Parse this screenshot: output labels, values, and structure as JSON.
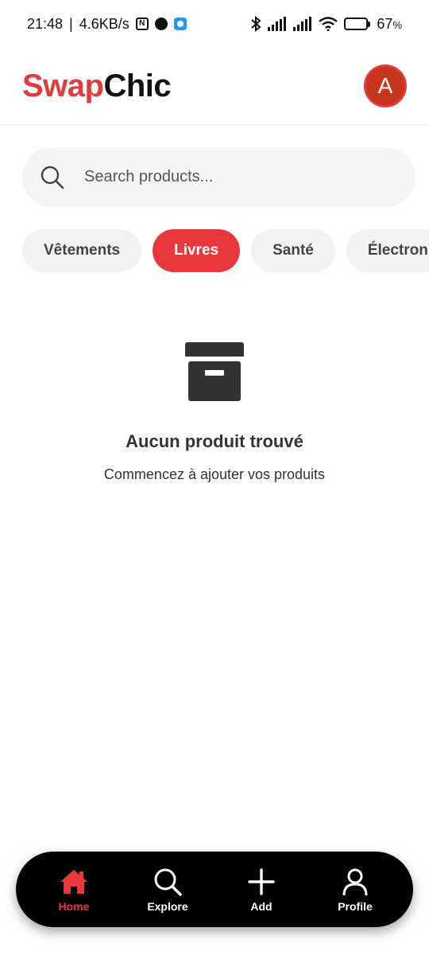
{
  "status_bar": {
    "time": "21:48",
    "network_speed": "4.6KB/s",
    "battery_percent": "67",
    "battery_unit": "%",
    "battery_level": 0.67,
    "icons": [
      "nfc-icon",
      "notification-icon",
      "app-notification-icon",
      "bluetooth-icon",
      "signal-icon",
      "signal-icon",
      "wifi-icon",
      "battery-icon"
    ]
  },
  "header": {
    "logo_part1": "Swap",
    "logo_part2": "Chic",
    "avatar_letter": "A",
    "colors": {
      "logo_accent": "#e23b3b",
      "avatar_bg": "#c7361c"
    }
  },
  "search": {
    "placeholder": "Search products...",
    "value": ""
  },
  "categories": {
    "items": [
      "Vêtements",
      "Livres",
      "Santé",
      "Électronique"
    ],
    "selected": "Livres",
    "active_color": "#e8383d"
  },
  "empty_state": {
    "icon": "archive-box-icon",
    "title": "Aucun produit trouvé",
    "subtitle": "Commencez à ajouter vos produits"
  },
  "bottom_nav": {
    "items": [
      {
        "label": "Home",
        "icon": "home-icon",
        "active": true
      },
      {
        "label": "Explore",
        "icon": "search-icon",
        "active": false
      },
      {
        "label": "Add",
        "icon": "plus-icon",
        "active": false
      },
      {
        "label": "Profile",
        "icon": "user-icon",
        "active": false
      }
    ],
    "active_color": "#e8383d"
  }
}
